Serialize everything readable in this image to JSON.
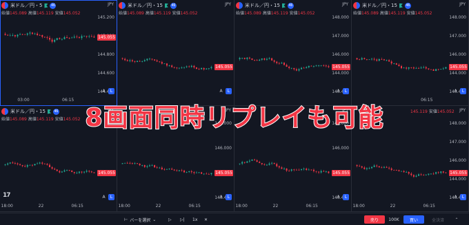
{
  "panes": [
    {
      "symbol": "米ドル／円・5",
      "badge": "46",
      "active": true,
      "show_ohlc": true,
      "y_ticks": [
        "145.200",
        "145.000",
        "144.800",
        "144.600",
        "144.400"
      ],
      "y_range": [
        144.3,
        145.3
      ],
      "price_tag_y": 145.055,
      "x_ticks": [
        {
          "t": "03:00",
          "f": 0.2
        },
        {
          "t": "06:15",
          "f": 0.58
        }
      ],
      "tv_logo": false
    },
    {
      "symbol": "米ドル／円・15",
      "badge": "46",
      "active": false,
      "show_ohlc": true,
      "y_ticks": [],
      "y_range": [
        143.3,
        148.7
      ],
      "price_tag_y": 145.055,
      "x_ticks": [],
      "tv_logo": false
    },
    {
      "symbol": "米ドル／円・15",
      "badge": "46",
      "active": false,
      "show_ohlc": true,
      "y_ticks": [
        "148.000",
        "147.000",
        "146.000",
        "144.000",
        "143.400"
      ],
      "y_range": [
        143.3,
        148.7
      ],
      "price_tag_y": 145.055,
      "x_ticks": [],
      "tv_logo": false
    },
    {
      "symbol": "米ドル／円・15",
      "badge": "46",
      "active": false,
      "show_ohlc": true,
      "y_ticks": [
        "148.000",
        "147.000",
        "146.000",
        "144.000",
        "143.400"
      ],
      "y_range": [
        143.3,
        148.7
      ],
      "price_tag_y": 145.055,
      "x_ticks": [
        {
          "t": "06:15",
          "f": 0.64
        }
      ],
      "tv_logo": false
    },
    {
      "symbol": "米ドル／円・15",
      "badge": "46",
      "active": false,
      "show_ohlc": true,
      "y_ticks": [],
      "y_range": [
        143.3,
        148.7
      ],
      "price_tag_y": 145.055,
      "x_ticks": [
        {
          "t": "18:00",
          "f": 0.06
        },
        {
          "t": "22",
          "f": 0.35
        },
        {
          "t": "06:15",
          "f": 0.66
        }
      ],
      "tv_logo": true
    },
    {
      "symbol": "",
      "badge": "",
      "active": false,
      "show_ohlc": false,
      "y_ticks": [
        "147.000",
        "146.000",
        "144.000",
        "143.400"
      ],
      "y_range": [
        143.3,
        148.7
      ],
      "price_tag_y": 145.055,
      "x_ticks": [
        {
          "t": "18:00",
          "f": 0.06
        },
        {
          "t": "22",
          "f": 0.35
        },
        {
          "t": "06:15",
          "f": 0.66
        }
      ],
      "tv_logo": false
    },
    {
      "symbol": "",
      "badge": "",
      "active": false,
      "show_ohlc": false,
      "y_ticks": [
        "147.000",
        "146.000",
        "144.000",
        "143.400"
      ],
      "y_range": [
        143.3,
        148.7
      ],
      "price_tag_y": 145.055,
      "x_ticks": [
        {
          "t": "18:00",
          "f": 0.06
        },
        {
          "t": "22",
          "f": 0.35
        },
        {
          "t": "06:15",
          "f": 0.66
        }
      ],
      "tv_logo": false
    },
    {
      "symbol": "",
      "badge": "",
      "active": false,
      "show_ohlc": true,
      "ohlc_partial": true,
      "y_ticks": [
        "148.000",
        "147.000",
        "146.000",
        "144.000",
        "143.400"
      ],
      "y_range": [
        143.3,
        148.7
      ],
      "price_tag_y": 145.055,
      "x_ticks": [
        {
          "t": "18:00",
          "f": 0.06
        },
        {
          "t": "22",
          "f": 0.35
        },
        {
          "t": "06:15",
          "f": 0.66
        }
      ],
      "tv_logo": false
    }
  ],
  "ohlc": {
    "open_label": "始値",
    "open": "145.089",
    "high_label": "高値",
    "high": "145.119",
    "low_label": "安値",
    "low": "145.052"
  },
  "ccy": "JPY",
  "price_tag": "145.055",
  "scale_a": "A",
  "scale_l": "L",
  "tv_logo_text": "17",
  "overlay_caption": "8画面同時リプレイも可能",
  "replay": {
    "bar_select": "バーを選択",
    "speed": "1x"
  },
  "trade": {
    "sell": "売り",
    "qty": "100K",
    "buy": "買い",
    "close": "全決済"
  },
  "colors": {
    "up": "#22ab94",
    "down": "#f23645",
    "accent": "#2962ff",
    "bg": "#131722"
  }
}
